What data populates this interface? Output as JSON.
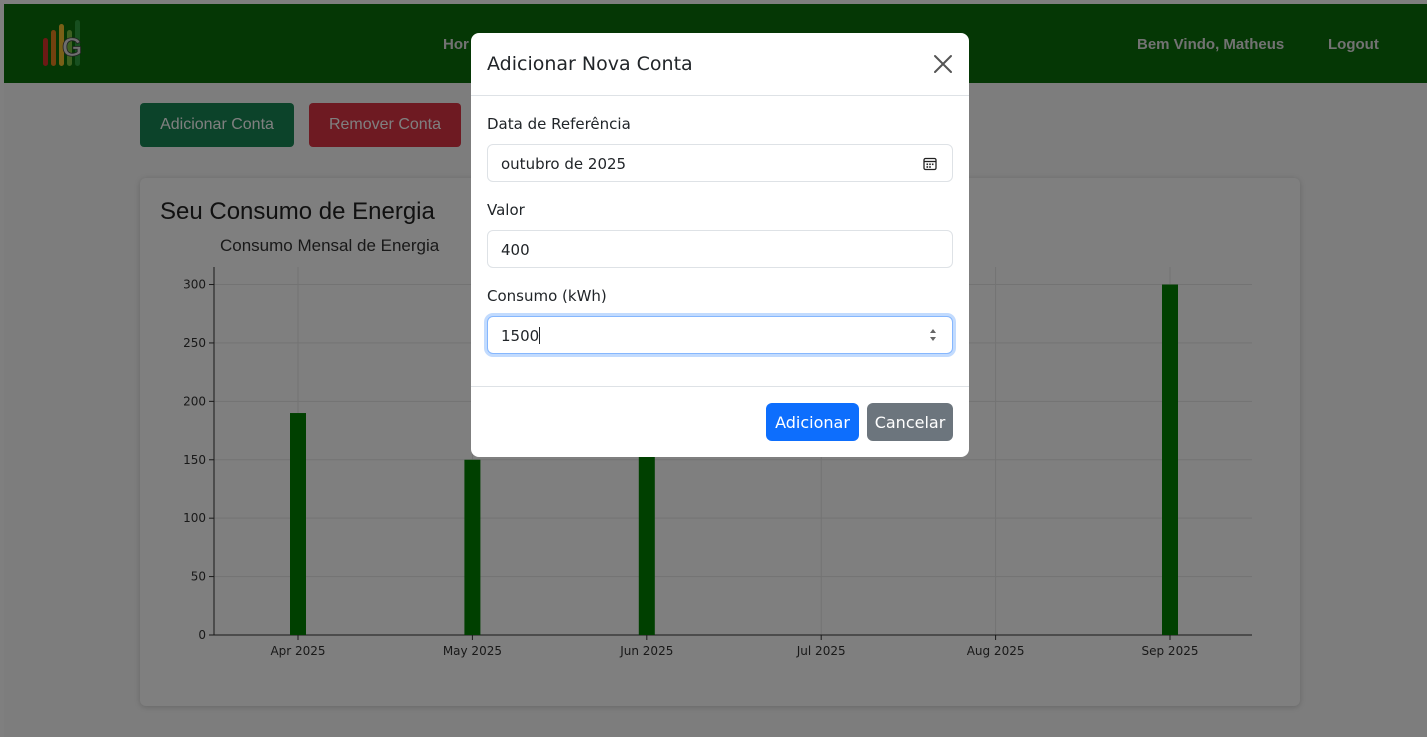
{
  "colors": {
    "navbar": "#0a6e0a",
    "primary": "#0d6efd",
    "secondary": "#6c757d",
    "success": "#198754",
    "danger": "#dc3545",
    "bar": "#008000"
  },
  "navbar": {
    "logo_letter": "G",
    "link_home": "Hor",
    "welcome": "Bem Vindo, Matheus",
    "logout": "Logout"
  },
  "actions": {
    "add_account": "Adicionar Conta",
    "remove_account": "Remover Conta"
  },
  "card": {
    "title": "Seu Consumo de Energia"
  },
  "chart_data": {
    "type": "bar",
    "title": "Consumo Mensal de Energia",
    "categories": [
      "Apr 2025",
      "May 2025",
      "Jun 2025",
      "Jul 2025",
      "Aug 2025",
      "Sep 2025"
    ],
    "values": [
      190,
      150,
      155,
      0,
      0,
      300
    ],
    "ylim": [
      0,
      315
    ],
    "yticks": [
      0,
      50,
      100,
      150,
      200,
      250,
      300
    ],
    "grid": true,
    "legend": "none"
  },
  "modal": {
    "title": "Adicionar Nova Conta",
    "close_icon": "close-icon",
    "date_label": "Data de Referência",
    "date_value": "outubro de 2025",
    "calendar_icon": "calendar-icon",
    "value_label": "Valor",
    "value_value": "400",
    "consumption_label": "Consumo (kWh)",
    "consumption_value": "1500",
    "submit": "Adicionar",
    "cancel": "Cancelar"
  }
}
